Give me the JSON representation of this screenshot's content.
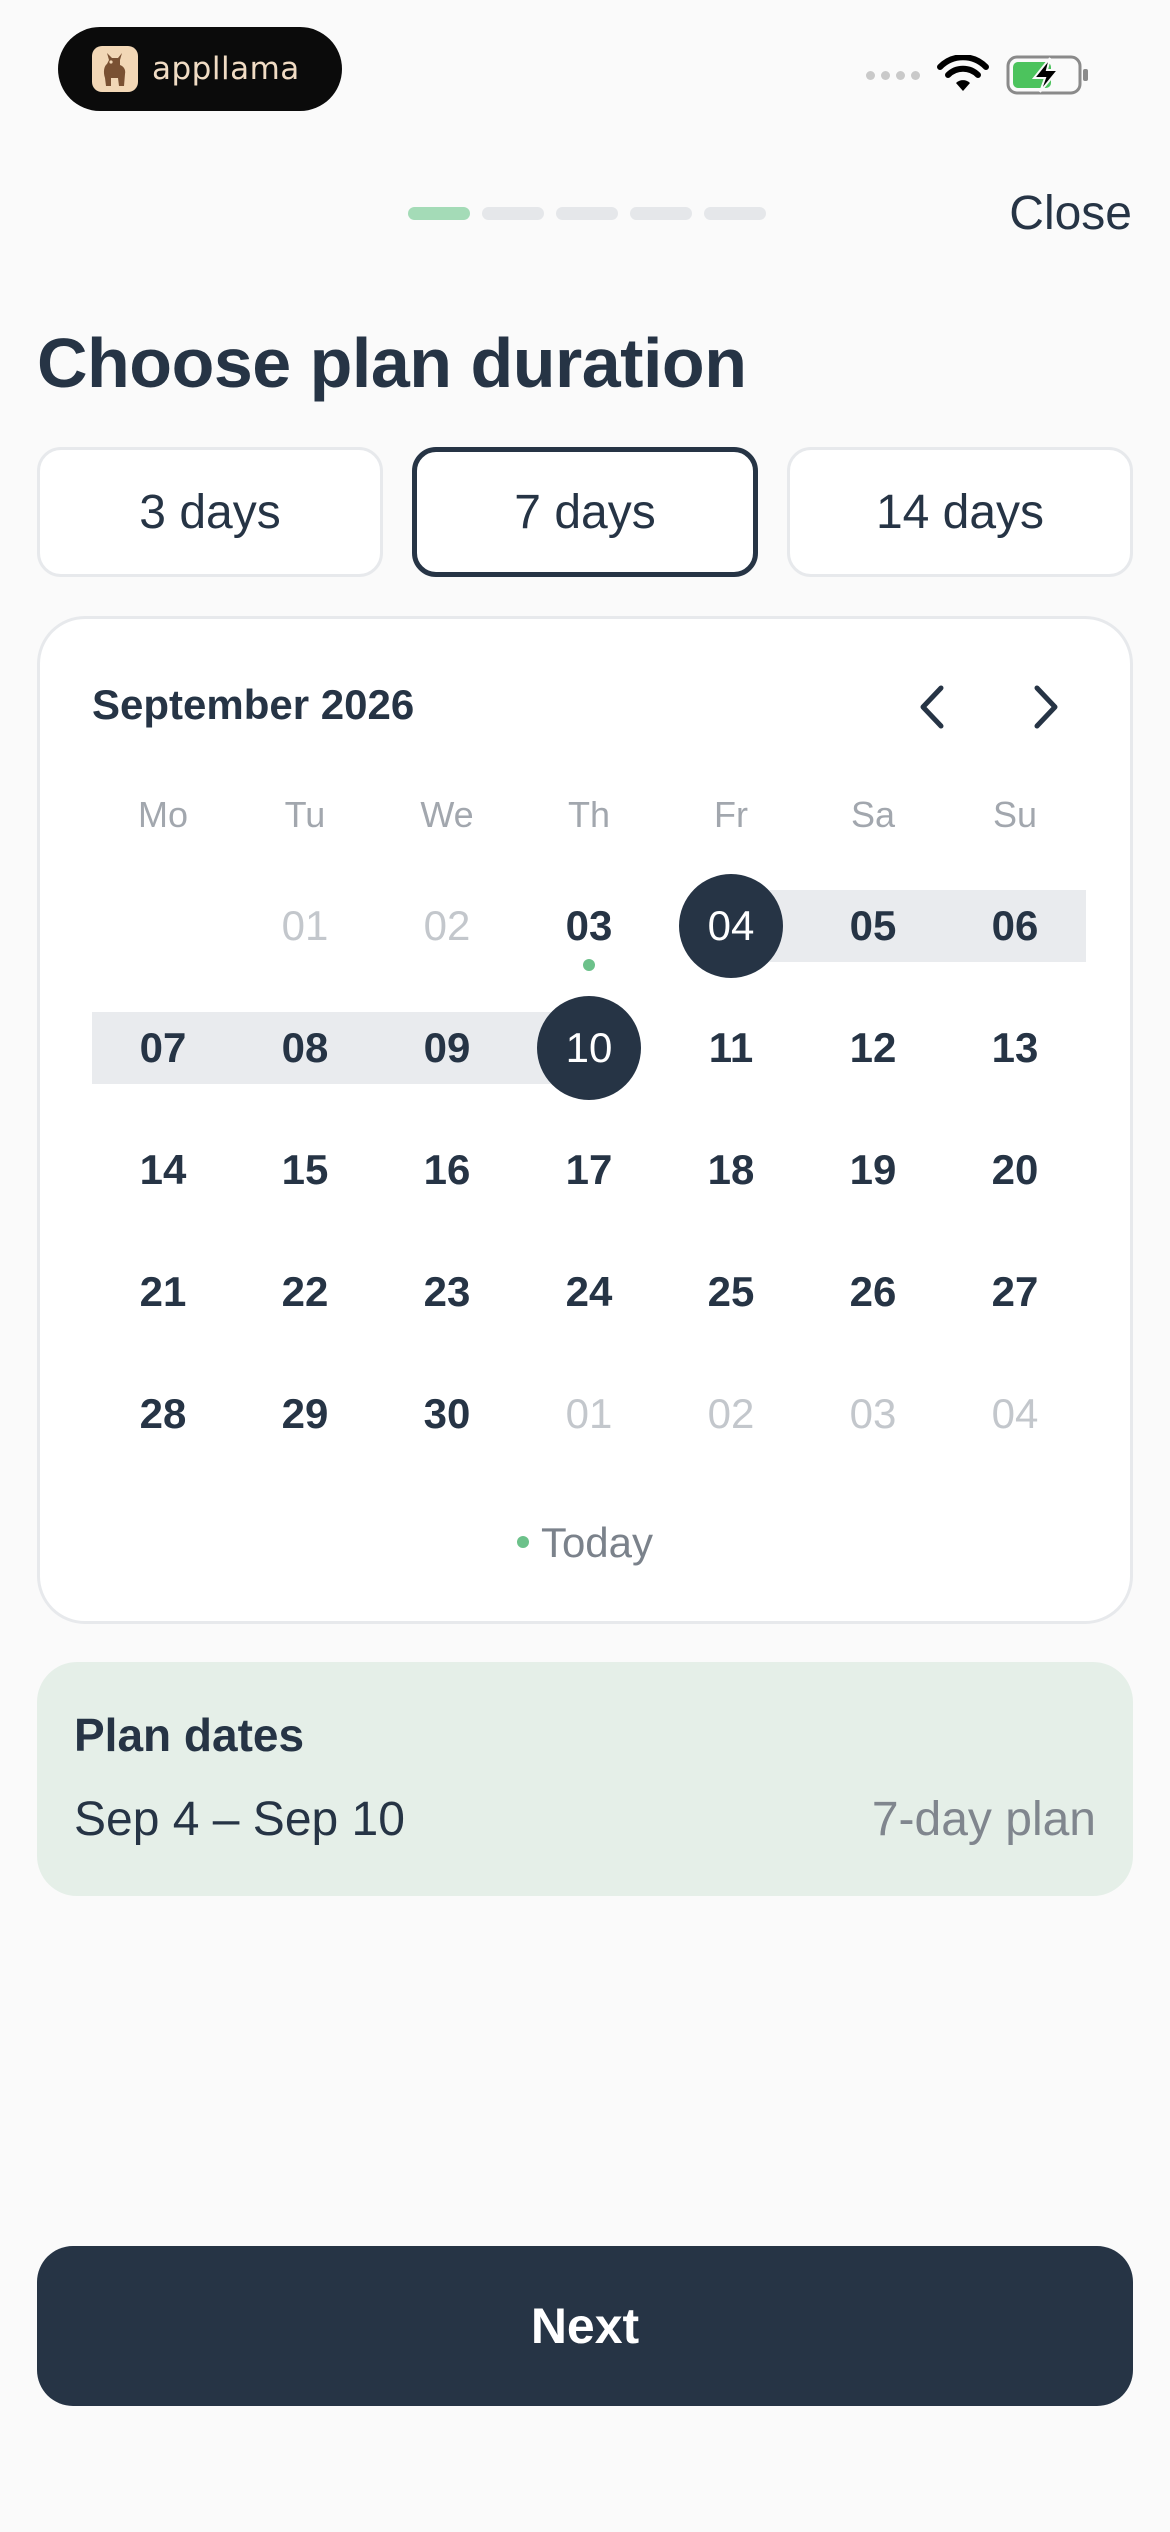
{
  "status_bar": {
    "app_name": "appllama"
  },
  "header": {
    "close_label": "Close",
    "progress": {
      "total_steps": 5,
      "current_step": 1
    }
  },
  "title": "Choose plan duration",
  "durations": [
    {
      "label": "3 days",
      "selected": false
    },
    {
      "label": "7 days",
      "selected": true
    },
    {
      "label": "14 days",
      "selected": false
    }
  ],
  "calendar": {
    "month_title": "September 2026",
    "weekdays": [
      "Mo",
      "Tu",
      "We",
      "Th",
      "Fr",
      "Sa",
      "Su"
    ],
    "days": [
      "",
      "01",
      "02",
      "03",
      "04",
      "05",
      "06",
      "07",
      "08",
      "09",
      "10",
      "11",
      "12",
      "13",
      "14",
      "15",
      "16",
      "17",
      "18",
      "19",
      "20",
      "21",
      "22",
      "23",
      "24",
      "25",
      "26",
      "27",
      "28",
      "29",
      "30",
      "01",
      "02",
      "03",
      "04"
    ],
    "range_start": "04",
    "range_end": "10",
    "today": "03",
    "legend_today": "Today"
  },
  "plan": {
    "heading": "Plan dates",
    "range_text": "Sep 4 – Sep 10",
    "length_text": "7-day plan"
  },
  "next_label": "Next",
  "colors": {
    "primary": "#263445",
    "accent_green": "#6cc18a",
    "progress_active": "#a4dbb7",
    "plan_bg": "#e5efe8"
  }
}
